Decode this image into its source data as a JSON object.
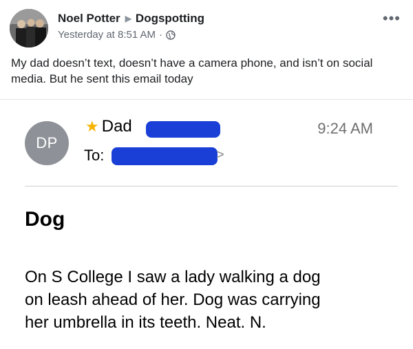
{
  "post": {
    "author": "Noel Potter",
    "group": "Dogspotting",
    "timestamp": "Yesterday at 8:51 AM",
    "separator": "·",
    "privacy_icon": "globe-icon",
    "more_label": "•••",
    "text": "My dad doesn’t text, doesn’t have a camera phone, and isn’t on social media. But he sent this email today"
  },
  "email": {
    "avatar_initials": "DP",
    "sender_name": "Dad",
    "star_icon": "star-icon",
    "to_label": "To:",
    "time": "9:24 AM",
    "subject": "Dog",
    "body_lines": [
      "On S College I saw a lady walking a dog",
      "on leash ahead of her.  Dog was carrying",
      "her umbrella in its teeth.  Neat.  N."
    ],
    "redaction_color": "#1a3fd6",
    "star_color": "#f5b400",
    "avatar_color": "#8e9298"
  }
}
